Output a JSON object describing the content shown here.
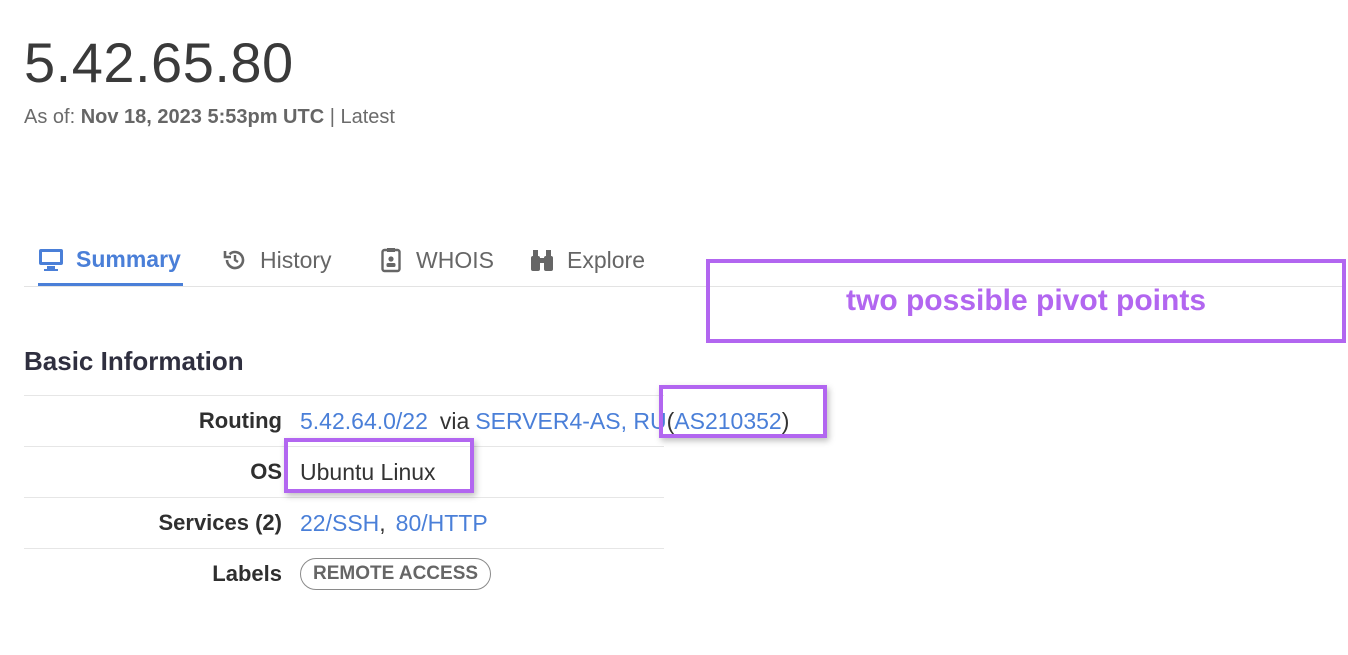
{
  "header": {
    "ip": "5.42.65.80",
    "as_of_prefix": "As of:",
    "as_of_date": "Nov 18, 2023 5:53pm UTC",
    "separator": "|",
    "latest": "Latest"
  },
  "tabs": [
    {
      "label": "Summary",
      "icon": "monitor-icon",
      "active": true
    },
    {
      "label": "History",
      "icon": "history-icon",
      "active": false
    },
    {
      "label": "WHOIS",
      "icon": "id-card-icon",
      "active": false
    },
    {
      "label": "Explore",
      "icon": "binoculars-icon",
      "active": false
    }
  ],
  "annotation": {
    "callout_text": "two possible pivot points",
    "color": "#b266f0"
  },
  "basic_info": {
    "title": "Basic Information",
    "routing": {
      "label": "Routing",
      "prefix": "5.42.64.0/22",
      "via": "via",
      "as_name": "SERVER4-AS, RU",
      "paren_open": "(",
      "asn": "AS210352",
      "paren_close": ")"
    },
    "os": {
      "label": "OS",
      "value": "Ubuntu Linux"
    },
    "services": {
      "label": "Services (2)",
      "items": [
        "22/SSH",
        "80/HTTP"
      ],
      "separator": ","
    },
    "labels": {
      "label": "Labels",
      "pill": "REMOTE ACCESS"
    }
  },
  "colors": {
    "link": "#4a7fd8",
    "accent": "#b266f0"
  }
}
